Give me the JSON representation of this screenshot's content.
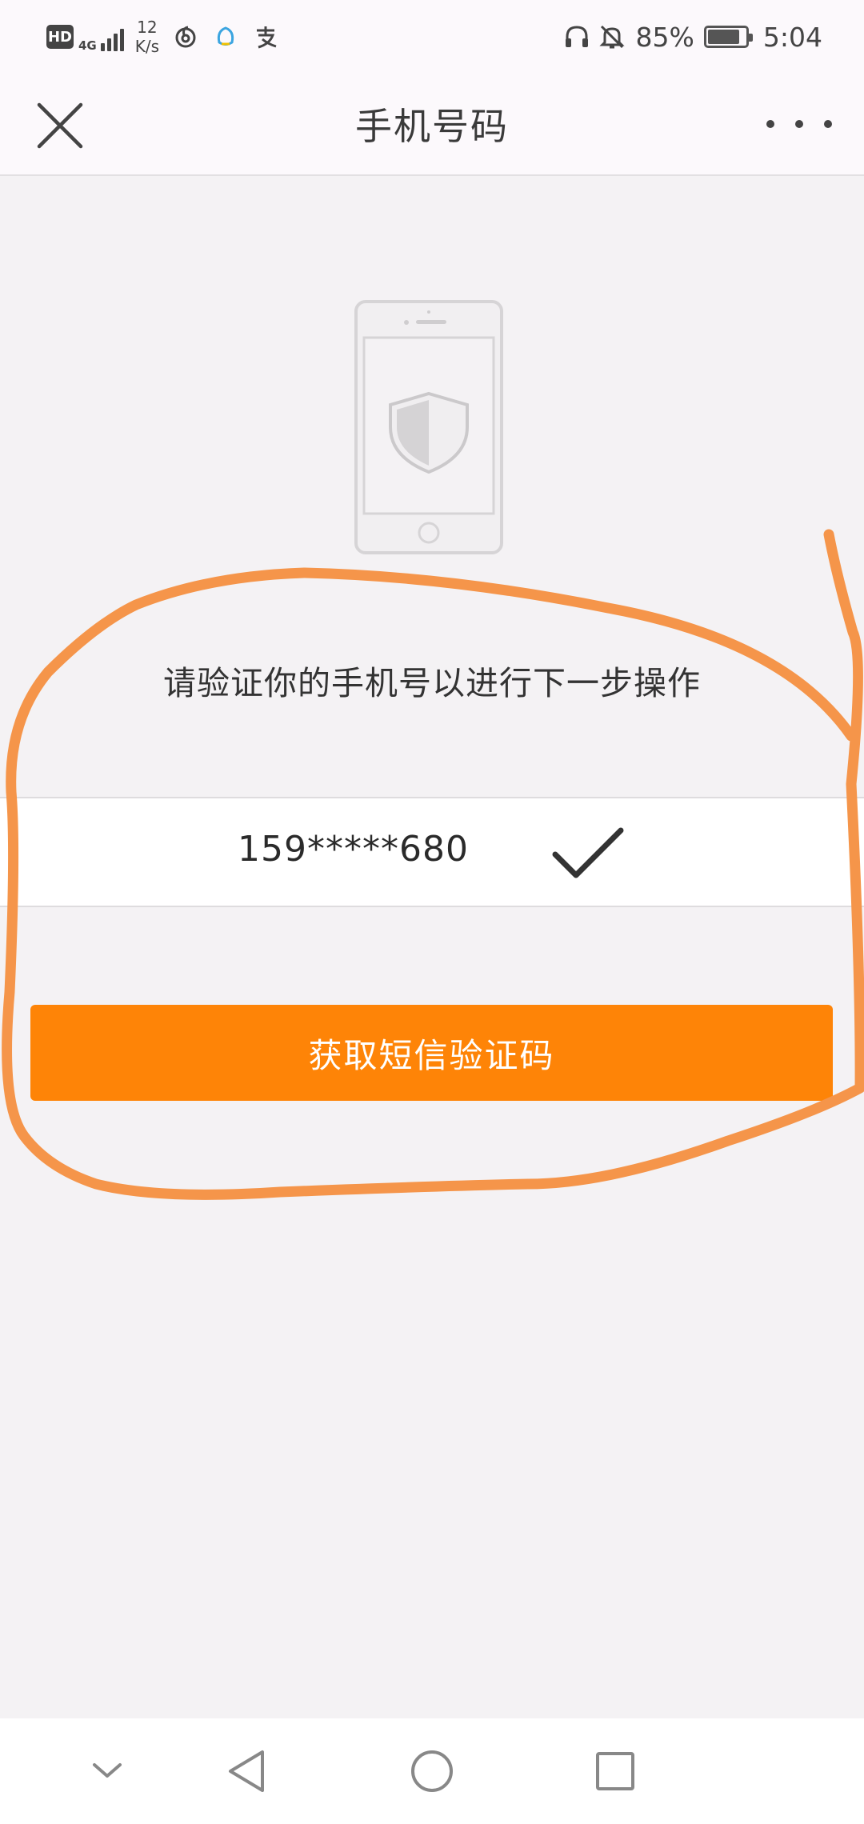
{
  "status_bar": {
    "hd_badge": "HD",
    "network_type": "4G",
    "speed_value": "12",
    "speed_unit": "K/s",
    "app_icons": [
      "netease-music-icon",
      "qq-icon",
      "alipay-icon"
    ],
    "status_icons": [
      "headphones-icon",
      "silent-bell-icon"
    ],
    "battery_percent": "85%",
    "battery_level": 0.85,
    "time": "5:04"
  },
  "title_bar": {
    "title": "手机号码",
    "close_icon": "close-icon",
    "more_icon": "more-icon"
  },
  "main": {
    "illustration_icon": "phone-shield-icon",
    "prompt": "请验证你的手机号以进行下一步操作",
    "phone_number": "159*****680",
    "verified_icon": "checkmark-icon",
    "sms_button_label": "获取短信验证码"
  },
  "nav_bar": {
    "items": [
      "collapse-icon",
      "back-icon",
      "home-icon",
      "recents-icon"
    ]
  },
  "colors": {
    "accent": "#fe8407",
    "annotation": "#f5954a",
    "background": "#f4f2f4",
    "header_background": "#fcf9fc"
  }
}
